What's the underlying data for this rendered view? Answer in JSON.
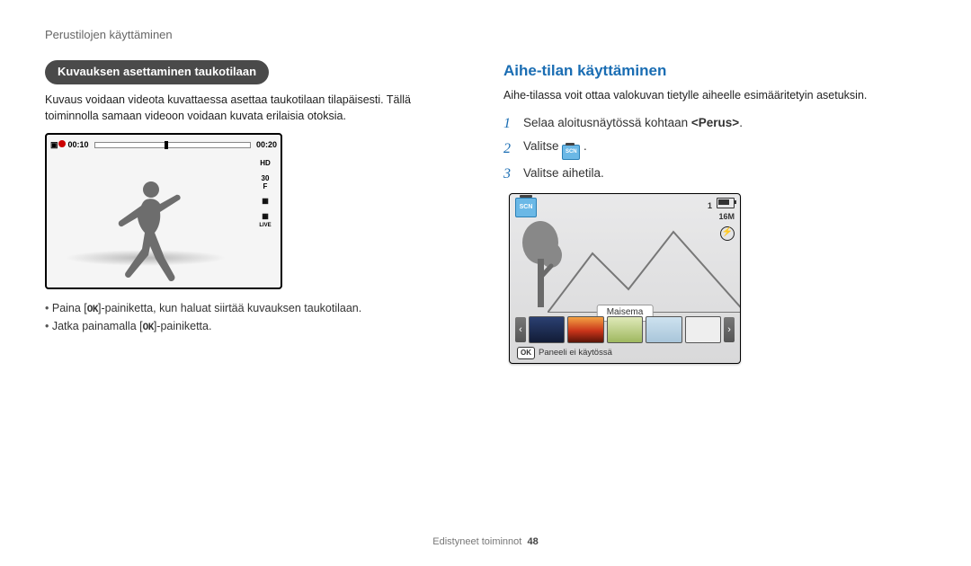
{
  "running_head": "Perustilojen käyttäminen",
  "left": {
    "pill": "Kuvauksen asettaminen taukotilaan",
    "para": "Kuvaus voidaan videota kuvattaessa asettaa taukotilaan tilapäisesti. Tällä toiminnolla samaan videoon voidaan kuvata erilaisia otoksia.",
    "lcd": {
      "time_elapsed": "00:10",
      "time_total": "00:20",
      "hd": "HD",
      "thirty": "30",
      "f": "F",
      "live": "LIVE"
    },
    "b1a": "Paina [",
    "b1b": "]-painiketta, kun haluat siirtää kuvauksen taukotilaan.",
    "b2a": "Jatka painamalla [",
    "b2b": "]-painiketta.",
    "ok": "OK"
  },
  "right": {
    "h2": "Aihe-tilan käyttäminen",
    "intro": "Aihe-tilassa voit ottaa valokuvan tietylle aiheelle esimääritetyin asetuksin.",
    "steps": {
      "s1a": "Selaa aloitusnäytössä kohtaan ",
      "s1b": "<Perus>",
      "s1c": ".",
      "s2a": "Valitse ",
      "s2b": " .",
      "s3": "Valitse aihetila."
    },
    "lcd": {
      "scn_text": "SCN",
      "sixteen": "16M",
      "one": "1",
      "mode_label": "Maisema",
      "ok": "OK",
      "ok_text": "Paneeli ei käytössä",
      "flash": "$"
    }
  },
  "footer": {
    "section": "Edistyneet toiminnot",
    "page": "48"
  }
}
